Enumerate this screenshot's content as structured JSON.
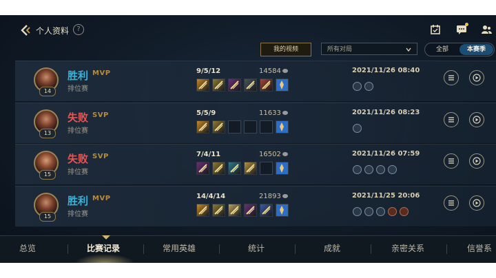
{
  "header": {
    "title": "个人资料",
    "help_label": "?"
  },
  "filters": {
    "videos_button": "我的视频",
    "match_select": "所有对局",
    "segment_all": "全部",
    "segment_season": "本赛季"
  },
  "matches": [
    {
      "level": "14",
      "result": "胜利",
      "honor": "MVP",
      "mode": "排位赛",
      "kda": "9/5/12",
      "gold": "14584",
      "date": "2021/11/26 08:40",
      "items": [
        "#c4872a",
        "#8d7a32",
        "#6a2f74",
        "#4b5358",
        "#a34536",
        "#b38a2c"
      ],
      "runes": [
        "gold",
        "blue",
        "blue"
      ]
    },
    {
      "level": "13",
      "result": "失败",
      "honor": "SVP",
      "mode": "排位赛",
      "kda": "5/5/9",
      "gold": "11633",
      "date": "2021/11/26 08:23",
      "items": [
        "#c4872a",
        "#8d7a32",
        "",
        "",
        "",
        ""
      ],
      "runes": [
        "blue"
      ]
    },
    {
      "level": "15",
      "result": "失败",
      "honor": "SVP",
      "mode": "排位赛",
      "kda": "7/4/11",
      "gold": "16502",
      "date": "2021/11/26 07:59",
      "items": [
        "#6a2f74",
        "#8d7a32",
        "#2f7a8a",
        "#b39340",
        "",
        ""
      ],
      "runes": [
        "blue",
        "blue",
        "blue",
        "blue"
      ]
    },
    {
      "level": "15",
      "result": "胜利",
      "honor": "MVP",
      "mode": "排位赛",
      "kda": "14/4/14",
      "gold": "21893",
      "date": "2021/11/25 20:06",
      "items": [
        "#c4872a",
        "#8d7a32",
        "#b8a060",
        "#6a2f74",
        "#3a5aa8",
        ""
      ],
      "runes": [
        "gold",
        "blue",
        "blue",
        "blue",
        "red",
        "red"
      ]
    }
  ],
  "nav": [
    "总览",
    "比赛记录",
    "常用英雄",
    "统计",
    "成就",
    "亲密关系",
    "信誉系统"
  ],
  "colors": {
    "win": "#37b3d9",
    "loss": "#e45757",
    "accent_gold": "#cdb773",
    "season_tab": "#1a4e75"
  }
}
